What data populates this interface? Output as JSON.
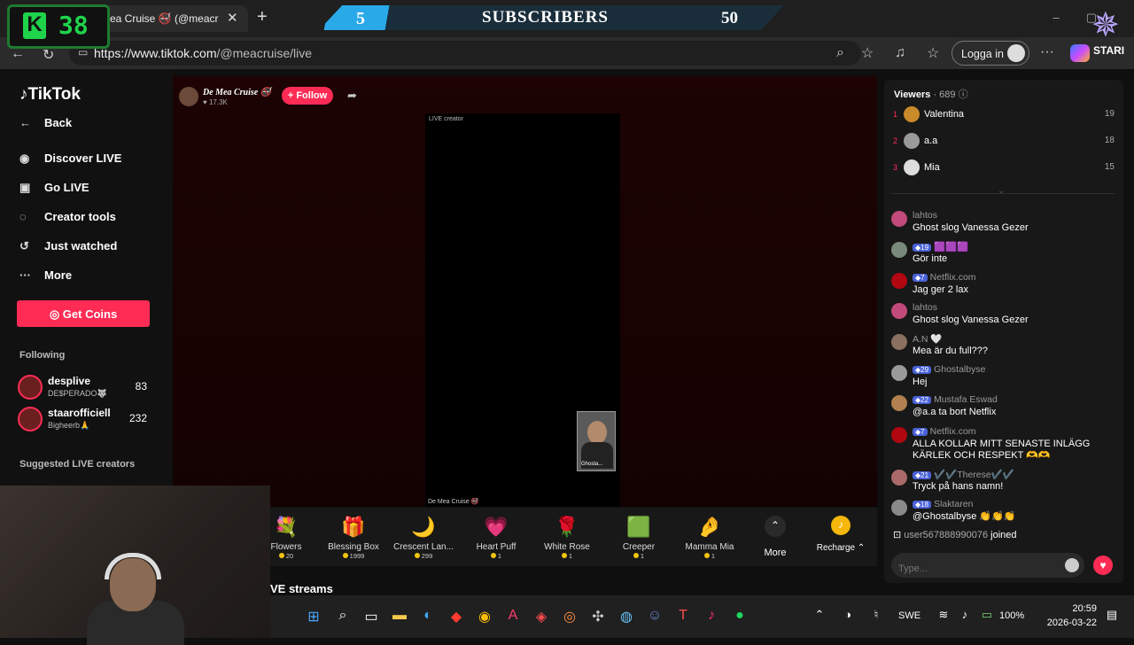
{
  "browser": {
    "tab_title": "ea Cruise 🚭 (@meacr",
    "url_domain": "https://www.tiktok.com",
    "url_path": "/@meacruise/live",
    "login_label": "Logga in"
  },
  "overlay": {
    "kick_count": "38",
    "kick_letter": "K",
    "sub_current": "5",
    "sub_label": "SUBSCRIBERS",
    "sub_goal": "50",
    "brand_label": "STARI"
  },
  "sidebar": {
    "logo": "TikTok",
    "nav": [
      {
        "label": "Back",
        "icon": "back-arrow-icon",
        "glyph": "←"
      },
      {
        "label": "Discover LIVE",
        "icon": "live-icon",
        "glyph": "◉"
      },
      {
        "label": "Go LIVE",
        "icon": "camera-icon",
        "glyph": "▣"
      },
      {
        "label": "Creator tools",
        "icon": "lightbulb-icon",
        "glyph": "◌"
      },
      {
        "label": "Just watched",
        "icon": "history-icon",
        "glyph": "↺"
      },
      {
        "label": "More",
        "icon": "more-icon",
        "glyph": "···"
      }
    ],
    "get_coins": "Get Coins",
    "following_title": "Following",
    "following": [
      {
        "name": "desplive",
        "sub": "DE$PERADO🐺",
        "count": "83"
      },
      {
        "name": "staarofficiell",
        "sub": "Bigheerb🙏",
        "count": "232"
      }
    ],
    "suggested_title": "Suggested LIVE creators"
  },
  "stream": {
    "host_name": "De Mea Cruise 🚭",
    "host_likes": "♥ 17.3K",
    "follow_label": "+ Follow",
    "live_label": "LIVE creator",
    "creator_label": "De Mea Cruise 🚭",
    "pip_label": "Ghosta..."
  },
  "gifts": [
    {
      "name": "Flowers",
      "price": "20",
      "glyph": "💐"
    },
    {
      "name": "Blessing Box",
      "price": "1999",
      "glyph": "🎁"
    },
    {
      "name": "Crescent Lan...",
      "price": "299",
      "glyph": "🌙"
    },
    {
      "name": "Heart Puff",
      "price": "1",
      "glyph": "💗"
    },
    {
      "name": "White Rose",
      "price": "1",
      "glyph": "🌹"
    },
    {
      "name": "Creeper",
      "price": "1",
      "glyph": "🟩"
    },
    {
      "name": "Mamma Mia",
      "price": "1",
      "glyph": "🤌"
    }
  ],
  "more_label": "More",
  "recharge_label": "Recharge ⌃",
  "streams_heading": "VE streams",
  "viewers": {
    "title": "Viewers",
    "count": "· 689",
    "ranks": [
      {
        "rank": "1",
        "name": "Valentina",
        "score": "19",
        "color": "#c98a2a"
      },
      {
        "rank": "2",
        "name": "a.a",
        "score": "18",
        "color": "#9a9a9a"
      },
      {
        "rank": "3",
        "name": "Mia",
        "score": "15",
        "color": "#dddddd"
      }
    ]
  },
  "chat": [
    {
      "user": "lahtos",
      "badge": "",
      "text": "Ghost slog Vanessa Gezer",
      "color": "#c04a7a"
    },
    {
      "user": "🟪🟪🟪",
      "badge": "19",
      "text": "Gör inte",
      "color": "#7a8a7a"
    },
    {
      "user": "Netflix.com",
      "badge": "7",
      "text": "Jag ger 2 lax",
      "color": "#b00710"
    },
    {
      "user": "lahtos",
      "badge": "",
      "text": "Ghost slog Vanessa Gezer",
      "color": "#c04a7a"
    },
    {
      "user": "A.N 🤍",
      "badge": "",
      "text": "Mea är du full???",
      "color": "#8a7060"
    },
    {
      "user": "Ghostalbyse",
      "badge": "29",
      "text": "Hej",
      "color": "#9a9a9a"
    },
    {
      "user": "Mustafa Eswad",
      "badge": "22",
      "text": "@a.a ta bort Netflix",
      "color": "#b08050"
    },
    {
      "user": "Netflix.com",
      "badge": "7",
      "text": "ALLA KOLLAR MITT SENASTE INLÄGG KÄRLEK OCH RESPEKT 🫶🫶",
      "color": "#b00710"
    },
    {
      "user": "✔️✔️Therese✔️✔️",
      "badge": "21",
      "text": "Tryck på hans namn!",
      "color": "#aa6a6a"
    },
    {
      "user": "Slaktaren",
      "badge": "18",
      "text": "@Ghostalbyse 👏👏👏",
      "color": "#8a8a8a"
    }
  ],
  "joined": {
    "user": "user567888990076",
    "text": "joined"
  },
  "type_placeholder": "Type...",
  "taskbar": {
    "lang": "SWE",
    "battery": "100%",
    "time": "20:59",
    "date": "2026-03-22"
  }
}
